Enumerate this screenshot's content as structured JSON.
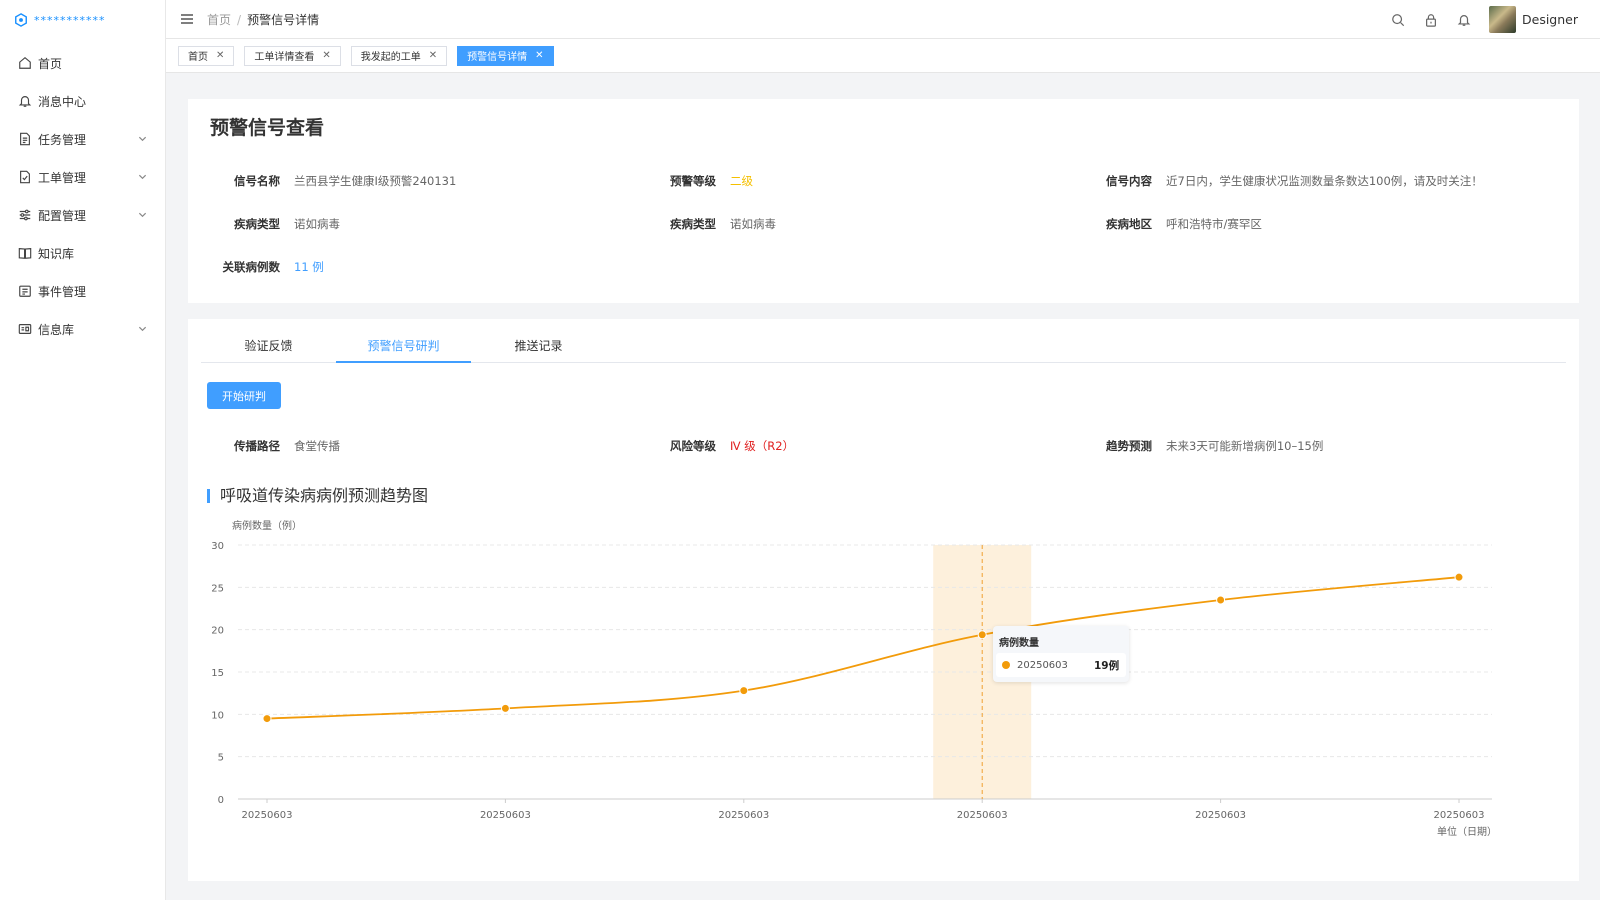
{
  "app": {
    "logo_text": "***********"
  },
  "sidebar": {
    "items": [
      {
        "label": "首页",
        "icon": "home-icon",
        "expandable": false
      },
      {
        "label": "消息中心",
        "icon": "bell-icon",
        "expandable": false
      },
      {
        "label": "任务管理",
        "icon": "document-icon",
        "expandable": true
      },
      {
        "label": "工单管理",
        "icon": "form-icon",
        "expandable": true
      },
      {
        "label": "配置管理",
        "icon": "sliders-icon",
        "expandable": true
      },
      {
        "label": "知识库",
        "icon": "book-icon",
        "expandable": false
      },
      {
        "label": "事件管理",
        "icon": "calendar-icon",
        "expandable": false
      },
      {
        "label": "信息库",
        "icon": "card-icon",
        "expandable": true
      }
    ]
  },
  "header": {
    "breadcrumb": {
      "home": "首页",
      "separator": "/",
      "current": "预警信号详情"
    },
    "user": {
      "name": "Designer"
    }
  },
  "page_tabs": [
    {
      "label": "首页",
      "active": false
    },
    {
      "label": "工单详情查看",
      "active": false
    },
    {
      "label": "我发起的工单",
      "active": false
    },
    {
      "label": "预警信号详情",
      "active": true
    }
  ],
  "detail": {
    "title": "预警信号查看",
    "signal_name": {
      "label": "信号名称",
      "value": "兰西县学生健康Ⅰ级预警240131"
    },
    "warning_level": {
      "label": "预警等级",
      "value": "二级",
      "color": "#f5c000"
    },
    "signal_content": {
      "label": "信号内容",
      "value": "近7日内，学生健康状况监测数量条数达100例，请及时关注！"
    },
    "disease_type_1": {
      "label": "疾病类型",
      "value": "诺如病毒"
    },
    "disease_type_2": {
      "label": "疾病类型",
      "value": "诺如病毒"
    },
    "disease_area": {
      "label": "疾病地区",
      "value": "呼和浩特市/赛罕区"
    },
    "related_cases": {
      "label": "关联病例数",
      "value": "11 例",
      "color": "#409eff"
    }
  },
  "analysis": {
    "tabs": [
      {
        "label": "验证反馈",
        "active": false
      },
      {
        "label": "预警信号研判",
        "active": true
      },
      {
        "label": "推送记录",
        "active": false
      }
    ],
    "start_button": "开始研判",
    "route": {
      "label": "传播路径",
      "value": "食堂传播"
    },
    "risk_level": {
      "label": "风险等级",
      "value": "Ⅳ 级（R2）",
      "color": "#e02020"
    },
    "trend": {
      "label": "趋势预测",
      "value": "未来3天可能新增病例10–15例"
    },
    "section_title": "呼吸道传染病病例预测趋势图"
  },
  "chart_data": {
    "type": "line",
    "title": "呼吸道传染病病例预测趋势图",
    "ylabel": "病例数量（例）",
    "xlabel": "单位（日期）",
    "categories": [
      "20250603",
      "20250603",
      "20250603",
      "20250603",
      "20250603",
      "20250603"
    ],
    "series": [
      {
        "name": "病例数量",
        "values": [
          9.5,
          10.7,
          12.8,
          19.4,
          23.5,
          26.2
        ],
        "color": "#f29b0a"
      }
    ],
    "ylim": [
      0,
      30
    ],
    "yticks": [
      0,
      5,
      10,
      15,
      20,
      25,
      30
    ],
    "grid": true,
    "smooth": true,
    "highlight_index": 3,
    "tooltip": {
      "title": "病例数量",
      "x": "20250603",
      "value": "19例"
    }
  }
}
